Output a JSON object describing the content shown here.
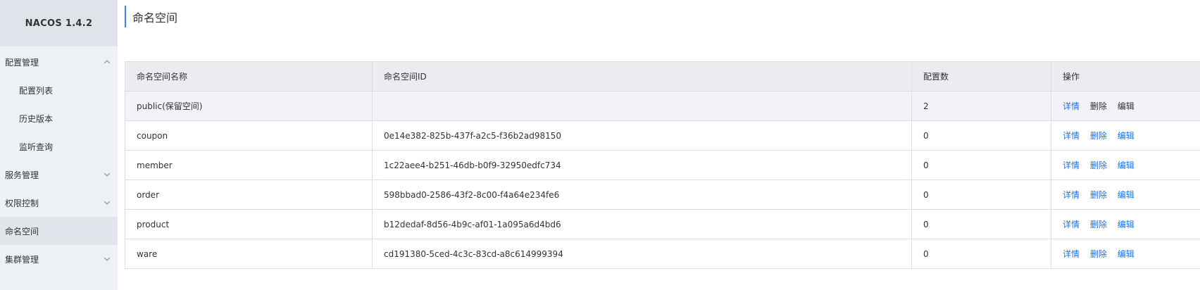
{
  "app": {
    "brand": "NACOS 1.4.2"
  },
  "sidebar": {
    "items": [
      {
        "label": "配置管理",
        "type": "group",
        "expanded": true
      },
      {
        "label": "配置列表",
        "type": "sub"
      },
      {
        "label": "历史版本",
        "type": "sub"
      },
      {
        "label": "监听查询",
        "type": "sub"
      },
      {
        "label": "服务管理",
        "type": "group",
        "expanded": false
      },
      {
        "label": "权限控制",
        "type": "group",
        "expanded": false
      },
      {
        "label": "命名空间",
        "type": "item",
        "active": true
      },
      {
        "label": "集群管理",
        "type": "group",
        "expanded": false
      }
    ]
  },
  "main": {
    "title": "命名空间",
    "table": {
      "headers": [
        "命名空间名称",
        "命名空间ID",
        "配置数",
        "操作"
      ],
      "actions": {
        "detail": "详情",
        "delete": "删除",
        "edit": "编辑"
      },
      "rows": [
        {
          "name": "public(保留空间)",
          "id": "",
          "count": "2",
          "reserved": true
        },
        {
          "name": "coupon",
          "id": "0e14e382-825b-437f-a2c5-f36b2ad98150",
          "count": "0",
          "reserved": false
        },
        {
          "name": "member",
          "id": "1c22aee4-b251-46db-b0f9-32950edfc734",
          "count": "0",
          "reserved": false
        },
        {
          "name": "order",
          "id": "598bbad0-2586-43f2-8c00-f4a64e234fe6",
          "count": "0",
          "reserved": false
        },
        {
          "name": "product",
          "id": "b12dedaf-8d56-4b9c-af01-1a095a6d4bd6",
          "count": "0",
          "reserved": false
        },
        {
          "name": "ware",
          "id": "cd191380-5ced-4c3c-83cd-a8c614999394",
          "count": "0",
          "reserved": false
        }
      ]
    }
  },
  "colors": {
    "link": "#1a73e8",
    "accent": "#2d8cf0",
    "sidebar_bg": "#eef1f6",
    "header_bg": "#ebecf0"
  }
}
